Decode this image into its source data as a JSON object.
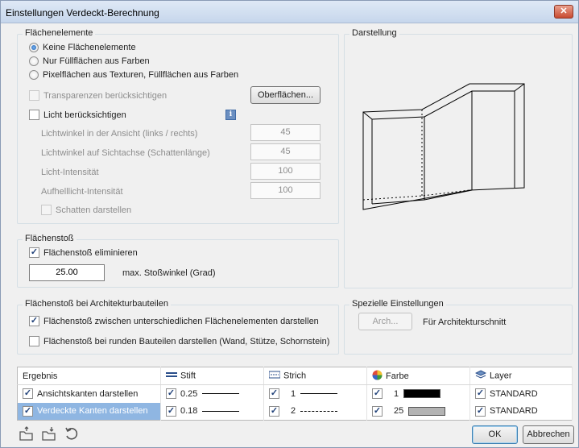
{
  "window": {
    "title": "Einstellungen Verdeckt-Berechnung",
    "close": "✕"
  },
  "flaechenelemente": {
    "legend": "Flächenelemente",
    "radios": [
      {
        "label": "Keine Flächenelemente",
        "selected": true
      },
      {
        "label": "Nur Füllflächen aus Farben",
        "selected": false
      },
      {
        "label": "Pixelflächen aus Texturen, Füllflächen aus Farben",
        "selected": false
      }
    ],
    "transparenzen": "Transparenzen berücksichtigen",
    "oberflaechen_button": "Oberflächen...",
    "licht": "Licht berücksichtigen",
    "info_icon": "i",
    "fields": [
      {
        "label": "Lichtwinkel in der Ansicht (links / rechts)",
        "value": "45"
      },
      {
        "label": "Lichtwinkel auf Sichtachse (Schattenlänge)",
        "value": "45"
      },
      {
        "label": "Licht-Intensität",
        "value": "100"
      },
      {
        "label": "Aufhelllicht-Intensität",
        "value": "100"
      }
    ],
    "schatten": "Schatten darstellen"
  },
  "darstellung": {
    "legend": "Darstellung"
  },
  "flaechenstoss": {
    "legend": "Flächenstoß",
    "eliminieren": "Flächenstoß eliminieren",
    "angle_value": "25.00",
    "angle_label": "max. Stoßwinkel (Grad)"
  },
  "architektur": {
    "legend": "Flächenstoß bei Architekturbauteilen",
    "option1": "Flächenstoß zwischen unterschiedlichen Flächenelementen darstellen",
    "option2": "Flächenstoß bei runden Bauteilen darstellen (Wand, Stütze, Schornstein)"
  },
  "spezielle": {
    "legend": "Spezielle Einstellungen",
    "arch_button": "Arch...",
    "arch_label": "Für Architekturschnitt"
  },
  "result_table": {
    "headers": [
      "Ergebnis",
      "Stift",
      "Strich",
      "Farbe",
      "Layer"
    ],
    "rows": [
      {
        "label": "Ansichtskanten darstellen",
        "stift": "0.25",
        "strich": "1",
        "farbe": "1",
        "layer": "STANDARD",
        "swatch": "#000000"
      },
      {
        "label": "Verdeckte Kanten darstellen",
        "stift": "0.18",
        "strich": "2",
        "farbe": "25",
        "layer": "STANDARD",
        "swatch": "#b3b3b3"
      }
    ]
  },
  "footer": {
    "ok": "OK",
    "cancel": "Abbrechen"
  },
  "icons": [
    "folder-open-icon",
    "folder-save-icon",
    "reset-icon"
  ]
}
